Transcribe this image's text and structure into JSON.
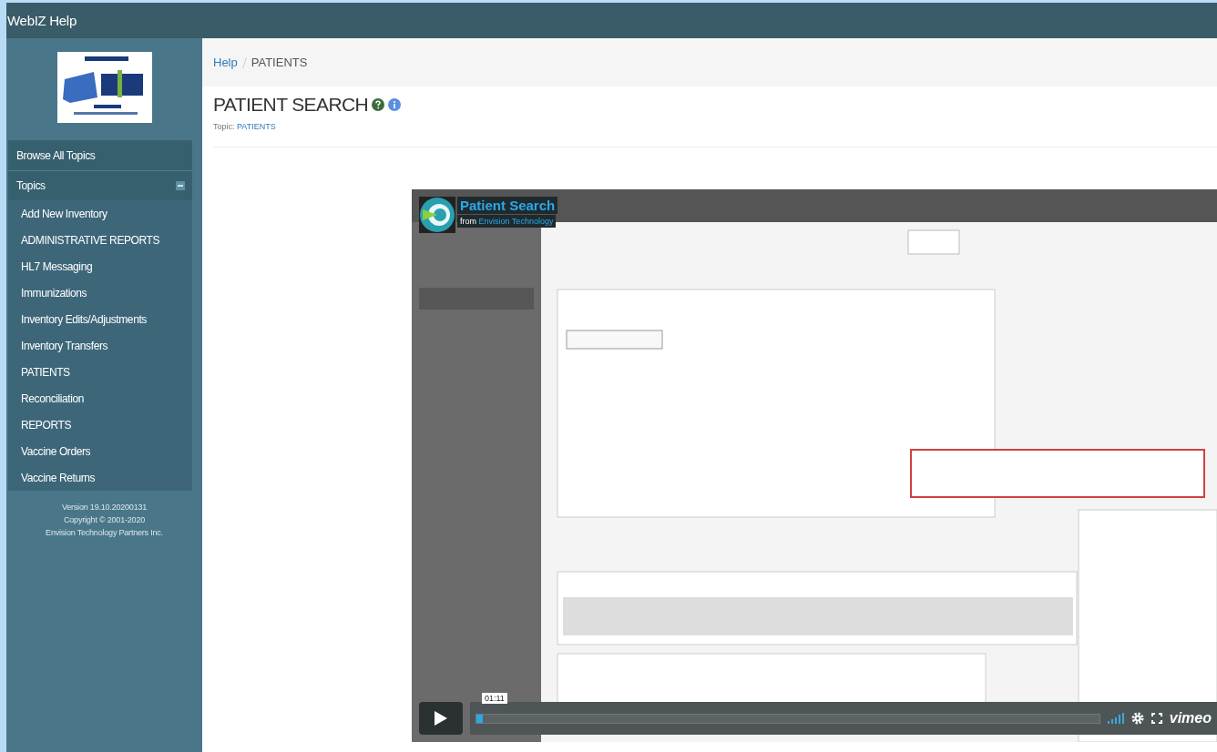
{
  "header": {
    "title": "WebIZ Help"
  },
  "sidebar": {
    "browse": "Browse All Topics",
    "topics_label": "Topics",
    "topics_expanded": true,
    "items": [
      {
        "label": "Add New Inventory"
      },
      {
        "label": "ADMINISTRATIVE REPORTS"
      },
      {
        "label": "HL7 Messaging"
      },
      {
        "label": "Immunizations"
      },
      {
        "label": "Inventory Edits/Adjustments"
      },
      {
        "label": "Inventory Transfers"
      },
      {
        "label": "PATIENTS"
      },
      {
        "label": "Reconciliation"
      },
      {
        "label": "REPORTS"
      },
      {
        "label": "Vaccine Orders"
      },
      {
        "label": "Vaccine Returns"
      }
    ],
    "footer": [
      "Version 19.10.20200131",
      "Copyright © 2001-2020",
      "Envision Technology Partners Inc."
    ]
  },
  "breadcrumb": [
    {
      "label": "Help",
      "link": true
    },
    {
      "label": "PATIENTS",
      "link": false
    }
  ],
  "page": {
    "title": "PATIENT SEARCH",
    "topic_label": "Topic:",
    "topic": "PATIENTS"
  },
  "video": {
    "kind": "picture",
    "title": "Patient Search",
    "from": "from",
    "source": "Envision Technology",
    "time": "01:11",
    "level": 0.01,
    "brand": "vimeo"
  }
}
